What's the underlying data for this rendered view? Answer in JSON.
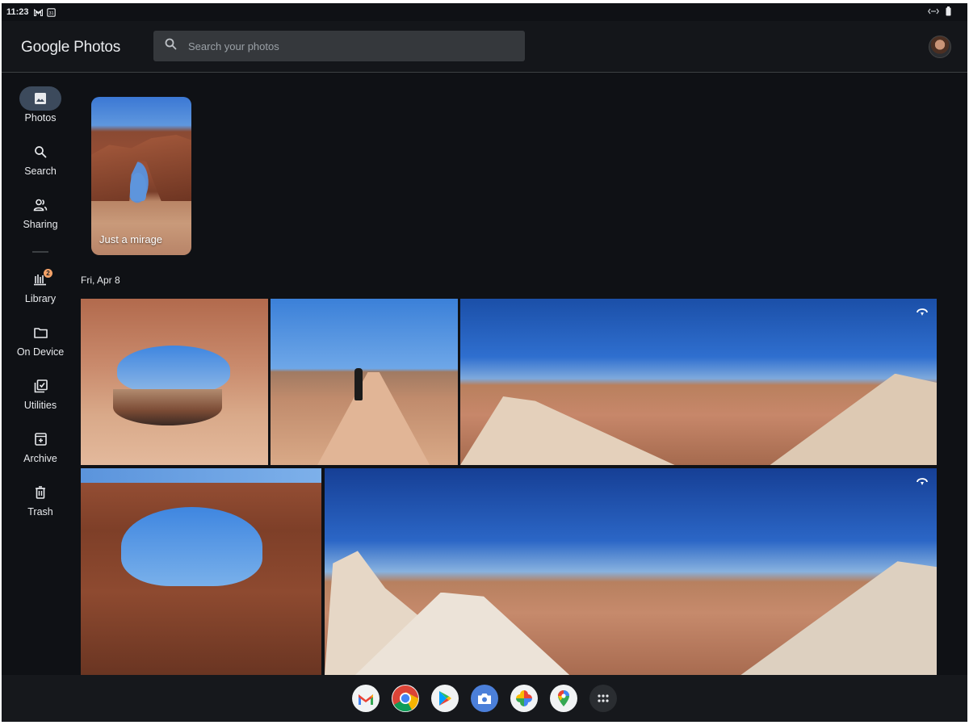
{
  "status_bar": {
    "time": "11:23",
    "left_icons": [
      "gmail-notification-icon",
      "calendar-notification-icon"
    ],
    "right_icons": [
      "network-icon",
      "battery-icon"
    ]
  },
  "header": {
    "app_title": "Google Photos",
    "search": {
      "placeholder": "Search your photos",
      "value": ""
    },
    "avatar": "user-avatar"
  },
  "sidebar": {
    "items": [
      {
        "id": "photos",
        "label": "Photos",
        "icon": "photo-icon",
        "active": true
      },
      {
        "id": "search",
        "label": "Search",
        "icon": "search-icon",
        "active": false
      },
      {
        "id": "sharing",
        "label": "Sharing",
        "icon": "people-icon",
        "active": false
      },
      {
        "id": "library",
        "label": "Library",
        "icon": "library-icon",
        "active": false,
        "badge": "2"
      },
      {
        "id": "on-device",
        "label": "On Device",
        "icon": "folder-icon",
        "active": false
      },
      {
        "id": "utilities",
        "label": "Utilities",
        "icon": "utilities-icon",
        "active": false
      },
      {
        "id": "archive",
        "label": "Archive",
        "icon": "archive-icon",
        "active": false
      },
      {
        "id": "trash",
        "label": "Trash",
        "icon": "trash-icon",
        "active": false
      }
    ]
  },
  "memories": [
    {
      "caption": "Just a mirage"
    }
  ],
  "groups": [
    {
      "date": "Fri, Apr 8",
      "photos": [
        {
          "id": "arch-1",
          "panorama": false
        },
        {
          "id": "hiker-trail",
          "panorama": false
        },
        {
          "id": "panorama-1",
          "panorama": true
        },
        {
          "id": "arch-2",
          "panorama": false
        },
        {
          "id": "panorama-2",
          "panorama": true
        }
      ]
    }
  ],
  "shelf": {
    "apps": [
      {
        "name": "Gmail",
        "icon": "gmail-icon"
      },
      {
        "name": "Chrome",
        "icon": "chrome-icon"
      },
      {
        "name": "Play Store",
        "icon": "play-store-icon"
      },
      {
        "name": "Camera",
        "icon": "camera-icon"
      },
      {
        "name": "Photos",
        "icon": "google-photos-icon"
      },
      {
        "name": "Maps",
        "icon": "maps-icon"
      },
      {
        "name": "Launcher",
        "icon": "app-launcher-icon"
      }
    ]
  },
  "colors": {
    "background": "#0f1115",
    "header": "#14161a",
    "search_field": "#35383c",
    "active_nav": "#3c4a5c",
    "badge": "#f4a268"
  }
}
